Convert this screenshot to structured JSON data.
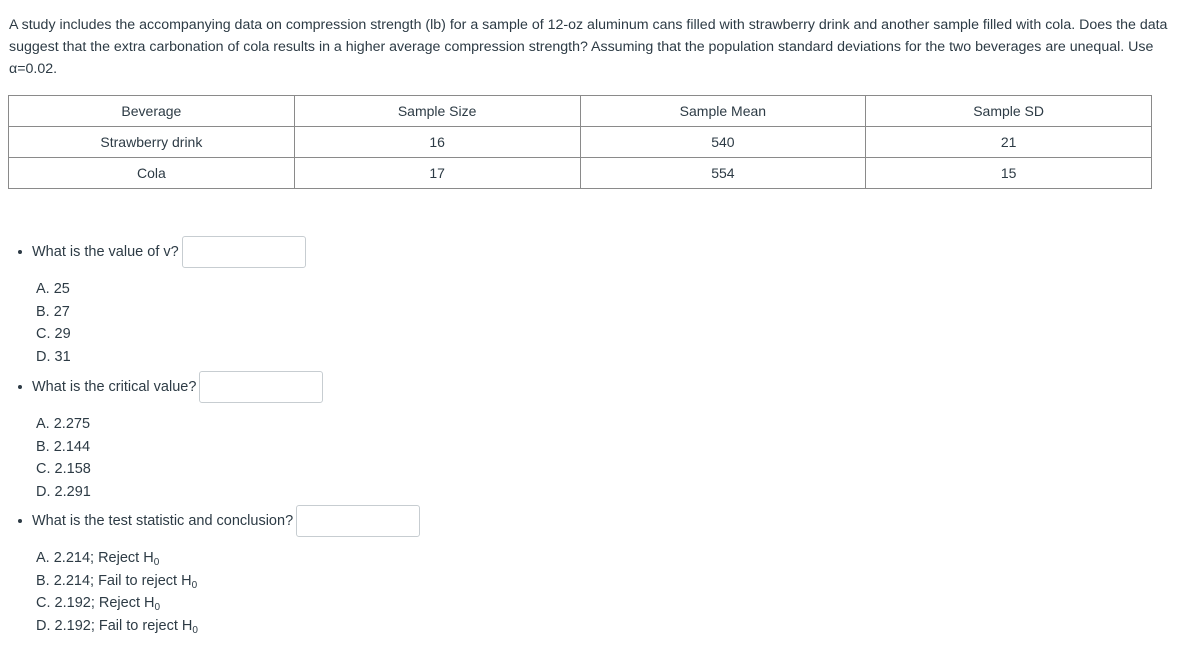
{
  "intro": {
    "text": "A study includes the accompanying data on compression strength (lb) for a sample of 12-oz aluminum cans filled with strawberry drink and another sample filled with cola. Does the data suggest that the extra carbonation of cola results in a higher average compression strength? Assuming that the population standard deviations for the two beverages are unequal. Use α=0.02."
  },
  "table": {
    "headers": [
      "Beverage",
      "Sample Size",
      "Sample Mean",
      "Sample SD"
    ],
    "rows": [
      [
        "Strawberry drink",
        "16",
        "540",
        "21"
      ],
      [
        "Cola",
        "17",
        "554",
        "15"
      ]
    ]
  },
  "questions": [
    {
      "text": "What is the value of v?",
      "answer_value": "",
      "options": [
        {
          "letter": "A.",
          "value": "25",
          "sub": ""
        },
        {
          "letter": "B.",
          "value": "27",
          "sub": ""
        },
        {
          "letter": "C.",
          "value": "29",
          "sub": ""
        },
        {
          "letter": "D.",
          "value": "31",
          "sub": ""
        }
      ]
    },
    {
      "text": "What is the critical value?",
      "answer_value": "",
      "options": [
        {
          "letter": "A.",
          "value": "2.275",
          "sub": ""
        },
        {
          "letter": "B.",
          "value": "2.144",
          "sub": ""
        },
        {
          "letter": "C.",
          "value": "2.158",
          "sub": ""
        },
        {
          "letter": "D.",
          "value": "2.291",
          "sub": ""
        }
      ]
    },
    {
      "text": "What is the test statistic and conclusion?",
      "answer_value": "",
      "options": [
        {
          "letter": "A.",
          "value": "2.214; Reject H",
          "sub": "0"
        },
        {
          "letter": "B.",
          "value": "2.214; Fail to reject H",
          "sub": "0"
        },
        {
          "letter": "C.",
          "value": "2.192; Reject H",
          "sub": "0"
        },
        {
          "letter": "D.",
          "value": "2.192; Fail to reject H",
          "sub": "0"
        }
      ]
    }
  ]
}
